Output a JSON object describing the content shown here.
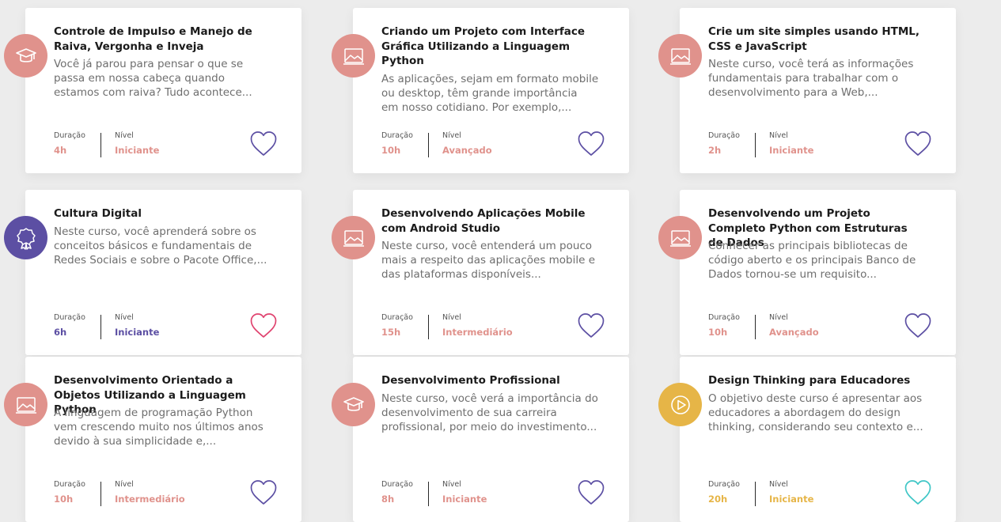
{
  "labels": {
    "duration": "Duração",
    "level": "Nível"
  },
  "courses": [
    {
      "title": "Controle de Impulso e Manejo de Raiva, Vergonha e Inveja",
      "description": "Você já parou para pensar o que se\npassa em nossa cabeça quando\nestamos com raiva? Tudo acontece...",
      "duration": "4h",
      "level": "Iniciante",
      "icon": "graduation-cap-icon",
      "badge_color": "#e0928c",
      "value_color": "#e0928c",
      "heart_color": "#5c4fa3"
    },
    {
      "title": "Criando um Projeto com Interface Gráfica Utilizando a Linguagem Python",
      "description": "As aplicações, sejam em formato mobile\nou desktop, têm grande importância\nem nosso cotidiano. Por exemplo,...",
      "duration": "10h",
      "level": "Avançado",
      "icon": "image-frame-icon",
      "badge_color": "#e0928c",
      "value_color": "#e0928c",
      "heart_color": "#5c4fa3"
    },
    {
      "title": "Crie um site simples usando HTML, CSS e JavaScript",
      "description": "Neste curso, você terá as informações\nfundamentais para trabalhar com o\ndesenvolvimento para a Web,...",
      "duration": "2h",
      "level": "Iniciante",
      "icon": "image-frame-icon",
      "badge_color": "#e0928c",
      "value_color": "#e0928c",
      "heart_color": "#5c4fa3"
    },
    {
      "title": "Cultura Digital",
      "description": "Neste curso, você aprenderá sobre os\nconceitos básicos e fundamentais de\nRedes Sociais e sobre o Pacote Office,...",
      "duration": "6h",
      "level": "Iniciante",
      "icon": "award-ribbon-icon",
      "badge_color": "#5c4fa3",
      "value_color": "#5c4fa3",
      "heart_color": "#e0436f"
    },
    {
      "title": "Desenvolvendo Aplicações Mobile com Android Studio",
      "description": "Neste curso, você entenderá um pouco\nmais a respeito das aplicações mobile e\ndas plataformas disponíveis...",
      "duration": "15h",
      "level": "Intermediário",
      "icon": "image-frame-icon",
      "badge_color": "#e0928c",
      "value_color": "#e0928c",
      "heart_color": "#5c4fa3"
    },
    {
      "title": "Desenvolvendo um Projeto Completo Python com Estruturas de Dados",
      "description": "Conhecer as principais bibliotecas de\ncódigo aberto e os principais Banco de\nDados tornou-se um requisito...",
      "duration": "10h",
      "level": "Avançado",
      "icon": "image-frame-icon",
      "badge_color": "#e0928c",
      "value_color": "#e0928c",
      "heart_color": "#5c4fa3"
    },
    {
      "title": "Desenvolvimento Orientado a Objetos Utilizando a Linguagem Python",
      "description": "A linguagem de programação Python\nvem crescendo muito nos últimos anos\ndevido à sua simplicidade e,...",
      "duration": "10h",
      "level": "Intermediário",
      "icon": "image-frame-icon",
      "badge_color": "#e0928c",
      "value_color": "#e0928c",
      "heart_color": "#5c4fa3"
    },
    {
      "title": "Desenvolvimento Profissional",
      "description": "Neste curso, você verá a importância do\ndesenvolvimento de sua carreira\nprofissional, por meio do investimento...",
      "duration": "8h",
      "level": "Iniciante",
      "icon": "graduation-cap-icon",
      "badge_color": "#e0928c",
      "value_color": "#e0928c",
      "heart_color": "#5c4fa3"
    },
    {
      "title": "Design Thinking para Educadores",
      "description": "O objetivo deste curso é apresentar aos\neducadores a abordagem do design\nthinking, considerando seu contexto e...",
      "duration": "20h",
      "level": "Iniciante",
      "icon": "play-circle-icon",
      "badge_color": "#e6b547",
      "value_color": "#e6b547",
      "heart_color": "#3fc6c6"
    }
  ]
}
